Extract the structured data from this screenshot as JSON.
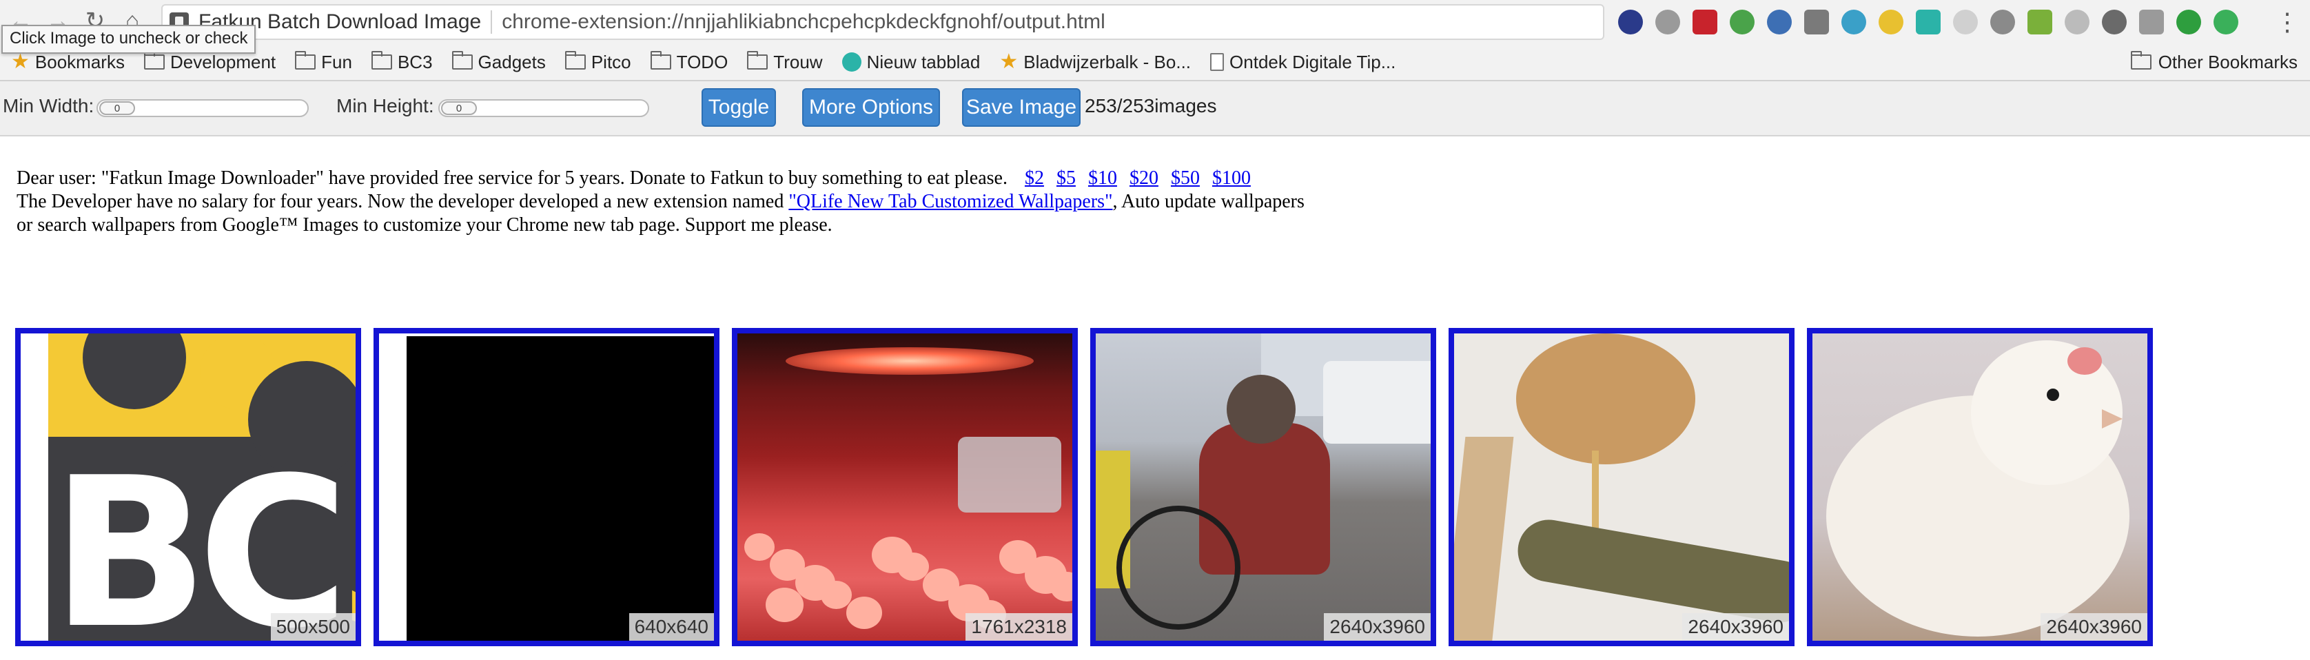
{
  "browser": {
    "tab_title": "Fatkun Batch Download Image",
    "url": "chrome-extension://nnjjahlikiabnchcpehcpkdeckfgnohf/output.html",
    "tooltip": "Click Image to uncheck or check",
    "nav": {
      "back_icon": "back-arrow-icon",
      "forward_icon": "forward-arrow-icon",
      "reload_icon": "reload-icon",
      "home_icon": "home-icon"
    },
    "extensions": [
      {
        "name": "ext-shield-icon",
        "color": "#2a3a8a"
      },
      {
        "name": "ext-speech-icon",
        "color": "#9a9a9a"
      },
      {
        "name": "ext-pinterest-icon",
        "color": "#c8232c"
      },
      {
        "name": "ext-pushbullet-icon",
        "color": "#4aa34a"
      },
      {
        "name": "ext-eyedropper-icon",
        "color": "#3d6fb4"
      },
      {
        "name": "ext-star-icon",
        "color": "#7a7a7a"
      },
      {
        "name": "ext-stack-icon",
        "color": "#3aa0c8"
      },
      {
        "name": "ext-yellow-icon",
        "color": "#e8c030"
      },
      {
        "name": "ext-teal-icon",
        "color": "#2bb3a8"
      },
      {
        "name": "ext-page-icon",
        "color": "#d0d0d0"
      },
      {
        "name": "ext-image-icon",
        "color": "#8a8a8a"
      },
      {
        "name": "ext-print-icon",
        "color": "#7ab03a"
      },
      {
        "name": "ext-js-icon",
        "color": "#bbbbbb"
      },
      {
        "name": "ext-camera-icon",
        "color": "#6a6a6a"
      },
      {
        "name": "ext-vuejs-icon",
        "color": "#9a9a9a"
      },
      {
        "name": "ext-evernote-icon",
        "color": "#2e9e3e"
      },
      {
        "name": "ext-check-icon",
        "color": "#3ab05a"
      }
    ]
  },
  "bookmarks": {
    "items": [
      {
        "label": "Bookmarks",
        "icon": "star-icon"
      },
      {
        "label": "Development",
        "icon": "folder-icon"
      },
      {
        "label": "Fun",
        "icon": "folder-icon"
      },
      {
        "label": "BC3",
        "icon": "folder-icon"
      },
      {
        "label": "Gadgets",
        "icon": "folder-icon"
      },
      {
        "label": "Pitco",
        "icon": "folder-icon"
      },
      {
        "label": "TODO",
        "icon": "folder-icon"
      },
      {
        "label": "Trouw",
        "icon": "folder-icon"
      },
      {
        "label": "Nieuw tabblad",
        "icon": "globe-icon"
      },
      {
        "label": "Bladwijzerbalk - Bo...",
        "icon": "star-icon"
      },
      {
        "label": "Ontdek Digitale Tip...",
        "icon": "page-icon"
      }
    ],
    "other": "Other Bookmarks"
  },
  "toolbar": {
    "min_width_label": "Min Width:",
    "min_width_value": "0",
    "min_height_label": "Min Height:",
    "min_height_value": "0",
    "toggle_label": "Toggle",
    "more_options_label": "More Options",
    "save_image_label": "Save Image",
    "count": "253/253images"
  },
  "notice": {
    "line1": "Dear user: \"Fatkun Image Downloader\" have provided free service for 5 years. Donate to Fatkun to buy something to eat please.",
    "donations": [
      "$2",
      "$5",
      "$10",
      "$20",
      "$50",
      "$100"
    ],
    "line2_pre": "The Developer have no salary for four years. Now the developer developed a new extension named ",
    "line2_link": "\"QLife New Tab Customized Wallpapers\"",
    "line2_post": ", Auto update wallpapers or search wallpapers from Google™ Images to customize your Chrome new tab page. Support me please."
  },
  "images": [
    {
      "dimensions": "500x500",
      "subject": "bc3-logo"
    },
    {
      "dimensions": "640x640",
      "subject": "black-image"
    },
    {
      "dimensions": "1761x2318",
      "subject": "chicks-under-heat-lamp"
    },
    {
      "dimensions": "2640x3960",
      "subject": "cyclist-on-street"
    },
    {
      "dimensions": "2640x3960",
      "subject": "chicken-on-perch"
    },
    {
      "dimensions": "2640x3960",
      "subject": "white-chick"
    }
  ],
  "colors": {
    "accent_button": "#3e86cf",
    "image_border": "#1414d4",
    "link": "#0000ee"
  }
}
